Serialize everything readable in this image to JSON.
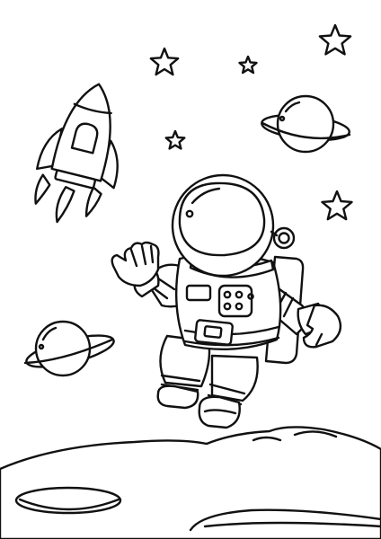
{
  "scene": {
    "subject": "astronaut-coloring-page",
    "line_color": "#111111",
    "fill_color": "#ffffff",
    "icons": [
      "rocket-icon",
      "star-icon",
      "planet-icon",
      "astronaut-icon",
      "moon-surface-icon"
    ]
  }
}
